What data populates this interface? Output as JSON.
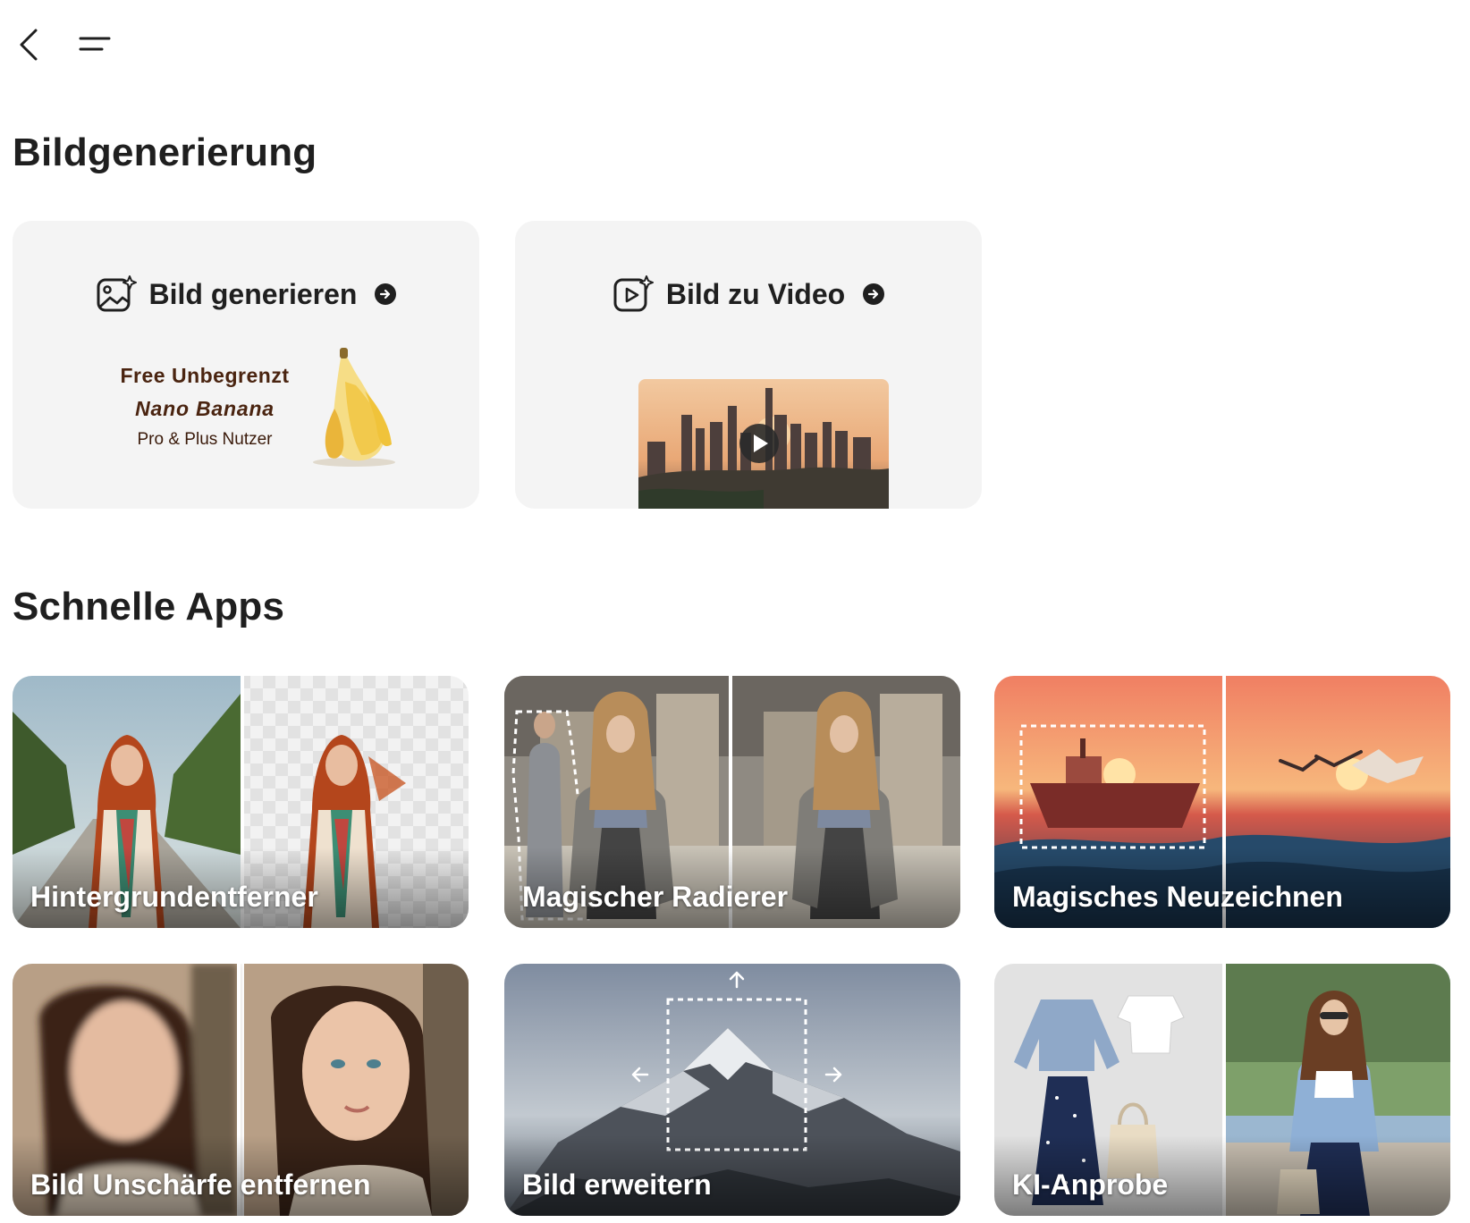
{
  "nav": {
    "back_icon": "chevron-left-icon",
    "menu_icon": "menu-icon"
  },
  "sections": {
    "image_generation": "Bildgenerierung",
    "quick_apps": "Schnelle Apps"
  },
  "gen_cards": {
    "generate_image": {
      "label": "Bild generieren",
      "icon": "image-sparkle-icon",
      "promo_line1": "Free Unbegrenzt",
      "promo_line2": "Nano Banana",
      "promo_line3": "Pro & Plus Nutzer"
    },
    "image_to_video": {
      "label": "Bild zu Video",
      "icon": "video-sparkle-icon"
    }
  },
  "apps": [
    {
      "label": "Hintergrundentferner"
    },
    {
      "label": "Magischer Radierer"
    },
    {
      "label": "Magisches Neuzeichnen"
    },
    {
      "label": "Bild Unschärfe entfernen"
    },
    {
      "label": "Bild erweitern"
    },
    {
      "label": "KI-Anprobe"
    }
  ],
  "colors": {
    "card_bg": "#f4f4f4",
    "promo_text": "#4a2410",
    "title_text": "#1f1f1f"
  }
}
